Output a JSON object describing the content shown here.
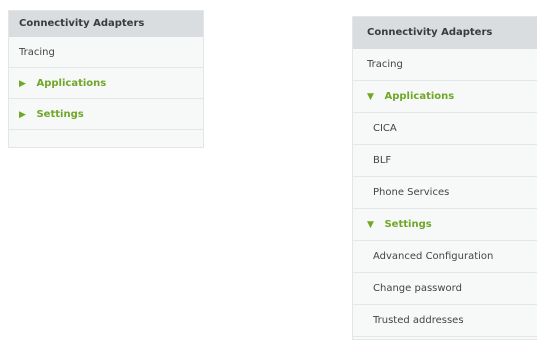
{
  "left_panel": {
    "header": "Connectivity Adapters",
    "items": [
      {
        "label": "Tracing"
      },
      {
        "label": "Applications",
        "section": true,
        "expanded": false
      },
      {
        "label": "Settings",
        "section": true,
        "expanded": false
      }
    ]
  },
  "right_panel": {
    "header": "Connectivity Adapters",
    "items": [
      {
        "label": "Tracing"
      },
      {
        "label": "Applications",
        "section": true,
        "expanded": true
      },
      {
        "label": "CICA"
      },
      {
        "label": "BLF"
      },
      {
        "label": "Phone Services"
      },
      {
        "label": "Settings",
        "section": true,
        "expanded": true
      },
      {
        "label": "Advanced Configuration"
      },
      {
        "label": "Change password"
      },
      {
        "label": "Trusted addresses"
      }
    ]
  },
  "icons": {
    "collapsed": "triangle-right-icon",
    "expanded": "triangle-down-icon"
  },
  "colors": {
    "section_green": "#6fa728",
    "header_bg": "#d9dde0"
  }
}
